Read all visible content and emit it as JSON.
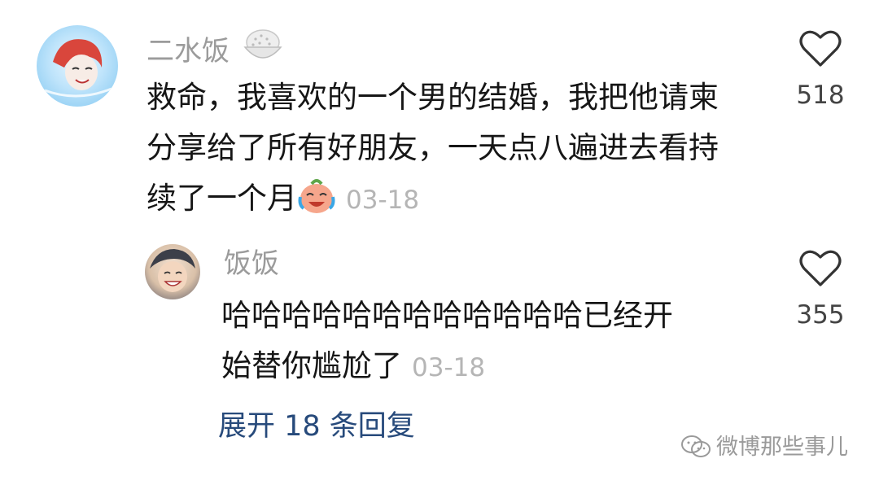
{
  "comment": {
    "username": "二水饭",
    "username_icon": "rice-bowl-icon",
    "text_line1": "救命，我喜欢的一个男的结婚，我把他请柬",
    "text_line2": "分享给了所有好朋友，一天点八遍进去看持",
    "text_line3": "续了一个月",
    "emoji": "crying-laughing-face-icon",
    "timestamp": "03-18",
    "likes": "518"
  },
  "reply": {
    "username": "饭饭",
    "text_line1": "哈哈哈哈哈哈哈哈哈哈哈哈已经开",
    "text_line2": "始替你尴尬了",
    "timestamp": "03-18",
    "likes": "355"
  },
  "expand_replies": "展开 18 条回复",
  "watermark": "微博那些事儿",
  "colors": {
    "link": "#274a7b",
    "muted": "#9b9b9b",
    "timestamp": "#b5b5b5",
    "text": "#161616"
  }
}
